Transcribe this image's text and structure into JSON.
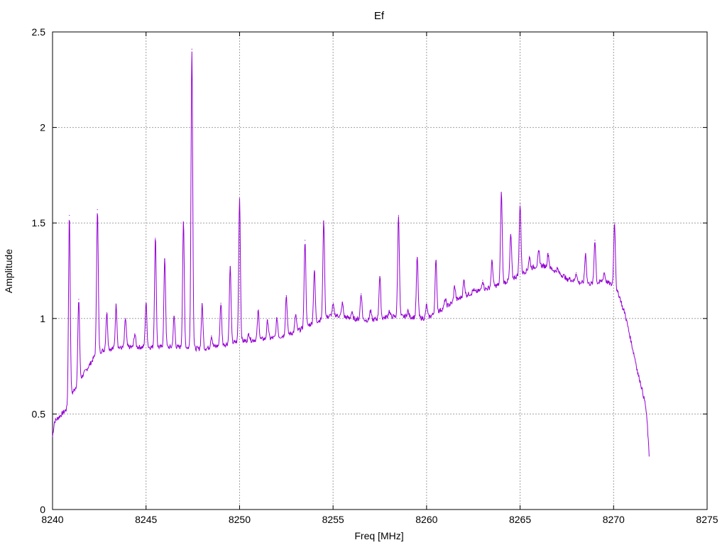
{
  "chart_data": {
    "type": "line",
    "title": "Ef",
    "xlabel": "Freq [MHz]",
    "ylabel": "Amplitude",
    "xlim": [
      8240,
      8275
    ],
    "ylim": [
      0,
      2.5
    ],
    "grid": true,
    "x_ticks": [
      8240,
      8245,
      8250,
      8255,
      8260,
      8265,
      8270,
      8275
    ],
    "y_ticks": [
      0,
      0.5,
      1,
      1.5,
      2,
      2.5
    ],
    "x_tick_labels": [
      "8240",
      "8245",
      "8250",
      "8255",
      "8260",
      "8265",
      "8270",
      "8275"
    ],
    "y_tick_labels": [
      "0",
      "0.5",
      "1",
      "1.5",
      "2",
      "2.5"
    ],
    "series_color": "#9400d3",
    "baseline": [
      [
        8240.0,
        0.38
      ],
      [
        8240.1,
        0.46
      ],
      [
        8240.3,
        0.48
      ],
      [
        8240.5,
        0.5
      ],
      [
        8240.8,
        0.53
      ],
      [
        8241.0,
        0.6
      ],
      [
        8241.3,
        0.65
      ],
      [
        8241.6,
        0.7
      ],
      [
        8242.0,
        0.76
      ],
      [
        8242.3,
        0.81
      ],
      [
        8242.6,
        0.83
      ],
      [
        8243.0,
        0.84
      ],
      [
        8244.0,
        0.85
      ],
      [
        8245.0,
        0.85
      ],
      [
        8246.0,
        0.85
      ],
      [
        8247.0,
        0.85
      ],
      [
        8248.0,
        0.84
      ],
      [
        8249.0,
        0.86
      ],
      [
        8250.0,
        0.88
      ],
      [
        8251.0,
        0.89
      ],
      [
        8252.0,
        0.9
      ],
      [
        8253.0,
        0.93
      ],
      [
        8254.0,
        0.98
      ],
      [
        8255.0,
        1.02
      ],
      [
        8256.0,
        1.0
      ],
      [
        8257.0,
        0.99
      ],
      [
        8258.0,
        1.01
      ],
      [
        8259.0,
        1.01
      ],
      [
        8260.0,
        1.0
      ],
      [
        8261.0,
        1.06
      ],
      [
        8262.0,
        1.12
      ],
      [
        8263.0,
        1.15
      ],
      [
        8264.0,
        1.18
      ],
      [
        8265.0,
        1.23
      ],
      [
        8265.5,
        1.26
      ],
      [
        8266.0,
        1.28
      ],
      [
        8266.5,
        1.27
      ],
      [
        8267.0,
        1.24
      ],
      [
        8268.0,
        1.19
      ],
      [
        8269.0,
        1.18
      ],
      [
        8269.5,
        1.2
      ],
      [
        8270.0,
        1.17
      ],
      [
        8270.3,
        1.12
      ],
      [
        8270.6,
        1.03
      ],
      [
        8271.0,
        0.85
      ],
      [
        8271.4,
        0.68
      ],
      [
        8271.7,
        0.55
      ],
      [
        8271.8,
        0.45
      ],
      [
        8271.9,
        0.28
      ]
    ],
    "peaks": [
      [
        8240.9,
        1.54
      ],
      [
        8241.4,
        1.1
      ],
      [
        8242.4,
        1.57
      ],
      [
        8242.9,
        1.03
      ],
      [
        8243.4,
        1.07
      ],
      [
        8243.9,
        1.0
      ],
      [
        8244.4,
        0.92
      ],
      [
        8245.0,
        1.08
      ],
      [
        8245.5,
        1.42
      ],
      [
        8246.0,
        1.31
      ],
      [
        8246.5,
        1.01
      ],
      [
        8247.0,
        1.5
      ],
      [
        8247.45,
        2.41
      ],
      [
        8248.0,
        1.07
      ],
      [
        8248.5,
        0.91
      ],
      [
        8249.0,
        1.08
      ],
      [
        8249.5,
        1.27
      ],
      [
        8250.0,
        1.63
      ],
      [
        8250.5,
        0.92
      ],
      [
        8251.0,
        1.04
      ],
      [
        8251.5,
        0.99
      ],
      [
        8252.0,
        1.0
      ],
      [
        8252.5,
        1.12
      ],
      [
        8253.0,
        1.02
      ],
      [
        8253.5,
        1.41
      ],
      [
        8254.0,
        1.25
      ],
      [
        8254.5,
        1.51
      ],
      [
        8255.0,
        1.07
      ],
      [
        8255.5,
        1.08
      ],
      [
        8256.0,
        1.03
      ],
      [
        8256.5,
        1.13
      ],
      [
        8257.0,
        1.04
      ],
      [
        8257.5,
        1.22
      ],
      [
        8258.0,
        1.04
      ],
      [
        8258.5,
        1.54
      ],
      [
        8259.0,
        1.04
      ],
      [
        8259.5,
        1.32
      ],
      [
        8260.0,
        1.07
      ],
      [
        8260.5,
        1.3
      ],
      [
        8261.0,
        1.1
      ],
      [
        8261.5,
        1.17
      ],
      [
        8262.0,
        1.2
      ],
      [
        8262.5,
        1.15
      ],
      [
        8263.0,
        1.2
      ],
      [
        8263.5,
        1.3
      ],
      [
        8264.0,
        1.66
      ],
      [
        8264.5,
        1.44
      ],
      [
        8265.0,
        1.6
      ],
      [
        8265.5,
        1.32
      ],
      [
        8266.0,
        1.35
      ],
      [
        8266.5,
        1.34
      ],
      [
        8267.0,
        1.26
      ],
      [
        8267.5,
        1.2
      ],
      [
        8268.0,
        1.24
      ],
      [
        8268.5,
        1.34
      ],
      [
        8269.0,
        1.41
      ],
      [
        8269.5,
        1.24
      ],
      [
        8270.05,
        1.5
      ],
      [
        8270.5,
        1.05
      ],
      [
        8271.3,
        0.71
      ]
    ]
  }
}
